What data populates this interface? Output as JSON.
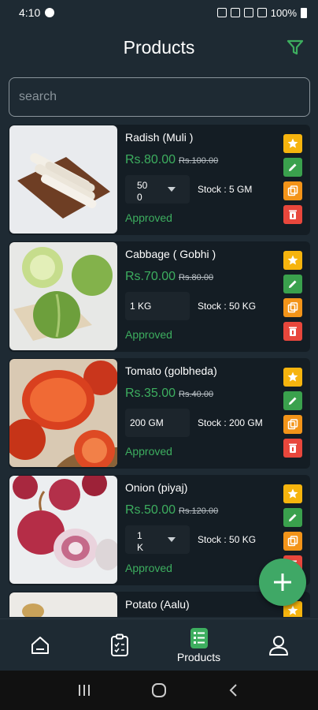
{
  "status_bar": {
    "time": "4:10",
    "battery": "100%"
  },
  "header": {
    "title": "Products"
  },
  "search": {
    "placeholder": "search"
  },
  "products": [
    {
      "name": "Radish (Muli )",
      "price": "Rs.80.00",
      "mrp": "Rs.100.00",
      "qty_line1": "50",
      "qty_line2": "0",
      "stock": "Stock : 5 GM",
      "status": "Approved"
    },
    {
      "name": "Cabbage ( Gobhi )",
      "price": "Rs.70.00",
      "mrp": "Rs.80.00",
      "qty": "1 KG",
      "stock": "Stock : 50 KG",
      "status": "Approved"
    },
    {
      "name": "Tomato (golbheda)",
      "price": "Rs.35.00",
      "mrp": "Rs.40.00",
      "qty": "200 GM",
      "stock": "Stock : 200 GM",
      "status": "Approved"
    },
    {
      "name": "Onion (piyaj)",
      "price": "Rs.50.00",
      "mrp": "Rs.120.00",
      "qty_line1": "1",
      "qty_line2": "K",
      "stock": "Stock : 50 KG",
      "status": "Approved"
    },
    {
      "name": "Potato (Aalu)"
    }
  ],
  "bottom_nav": {
    "products_label": "Products"
  },
  "colors": {
    "background": "#1e2a33",
    "card": "#141d24",
    "accent_green": "#3dae5f",
    "star": "#f6b40e",
    "edit": "#3aa14d",
    "copy": "#f39419",
    "delete": "#e8473c"
  },
  "icons": [
    "filter-icon",
    "star-icon",
    "edit-icon",
    "copy-icon",
    "delete-icon",
    "add-icon",
    "home-icon",
    "orders-icon",
    "products-icon",
    "profile-icon"
  ]
}
